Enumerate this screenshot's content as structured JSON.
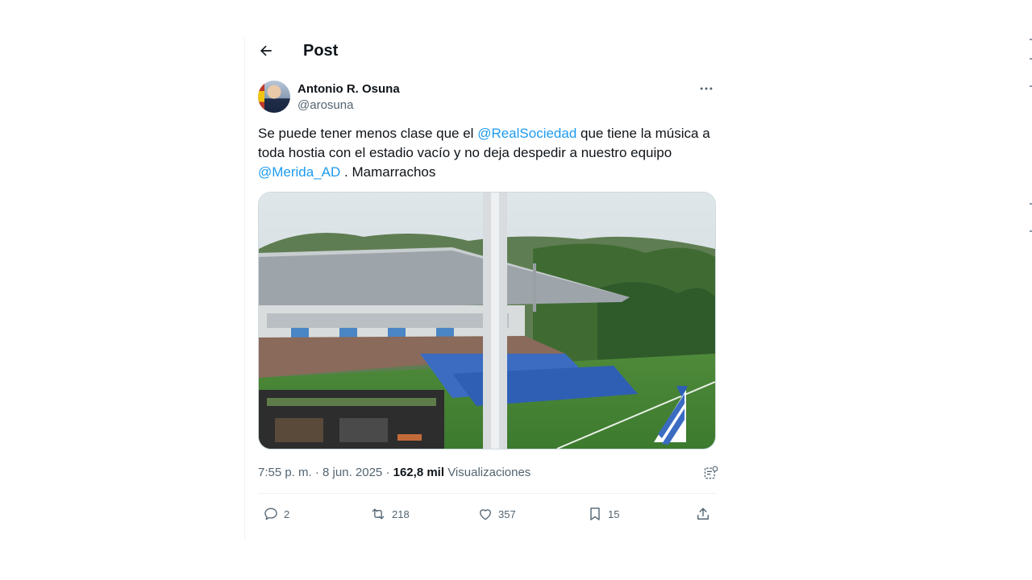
{
  "header": {
    "title": "Post"
  },
  "author": {
    "name": "Antonio R. Osuna",
    "handle": "@arosuna"
  },
  "tweet": {
    "segments": [
      {
        "text": "Se puede tener menos clase que el ",
        "mention": false
      },
      {
        "text": "@RealSociedad",
        "mention": true
      },
      {
        "text": " que tiene la música a toda hostia con el estadio vacío y no deja despedir a nuestro equipo ",
        "mention": false
      },
      {
        "text": "@Merida_AD",
        "mention": true
      },
      {
        "text": " . Mamarrachos",
        "mention": false
      }
    ]
  },
  "meta": {
    "time": "7:55 p. m.",
    "separator": "·",
    "date": "8 jun. 2025",
    "views_count": "162,8 mil",
    "views_label": "Visualizaciones"
  },
  "actions": {
    "replies": "2",
    "reposts": "218",
    "likes": "357",
    "bookmarks": "15"
  },
  "colors": {
    "accent": "#1d9bf0",
    "muted": "#536471",
    "text": "#0f1419"
  },
  "icons": [
    "back-arrow-icon",
    "more-icon",
    "grok-icon",
    "reply-icon",
    "repost-icon",
    "like-icon",
    "bookmark-icon",
    "share-icon"
  ]
}
